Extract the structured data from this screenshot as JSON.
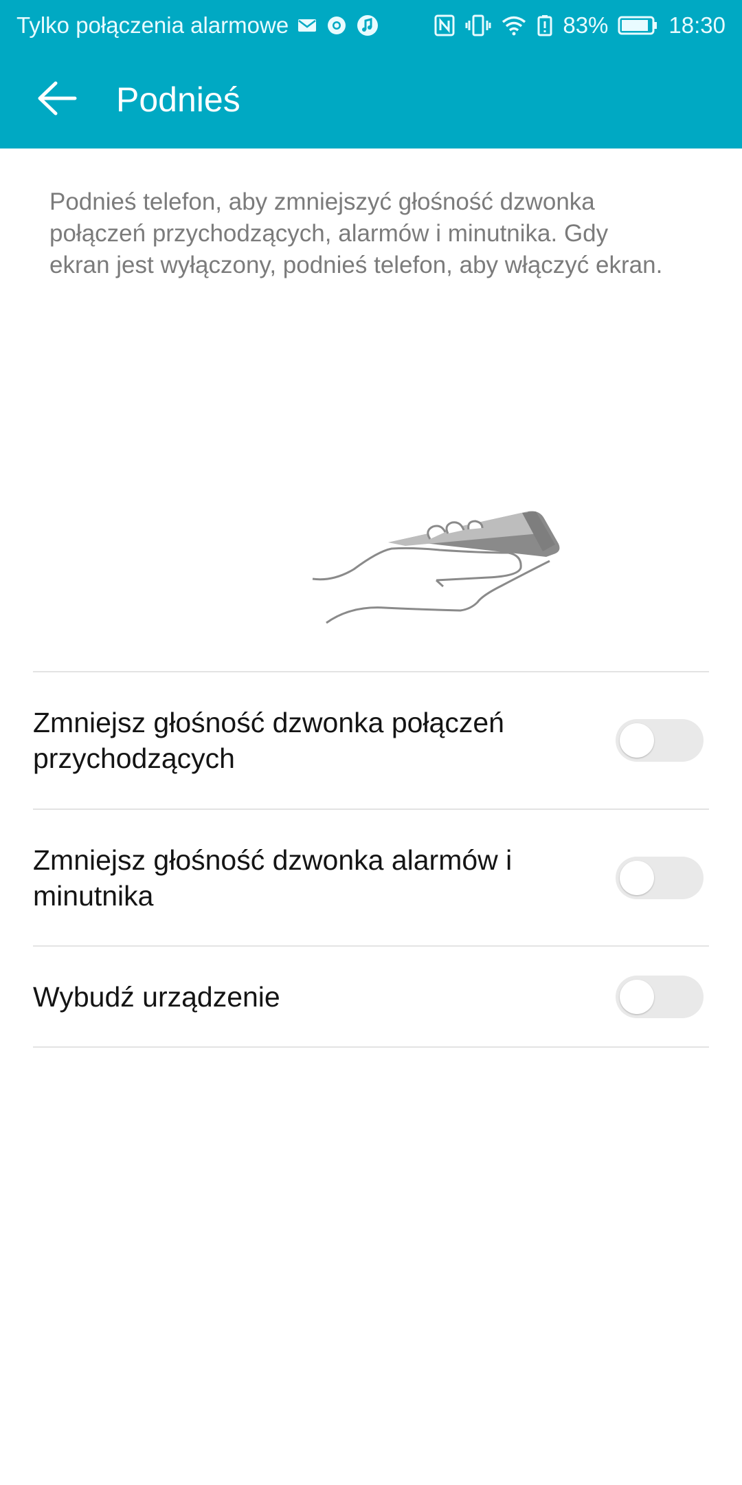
{
  "status_bar": {
    "left_text": "Tylko połączenia alarmowe",
    "icons": [
      "mail-icon",
      "chrome-icon",
      "music-icon",
      "nfc-icon",
      "vibrate-icon",
      "wifi-icon",
      "battery-alert-icon",
      "battery-icon"
    ],
    "battery_percent": "83%",
    "time": "18:30"
  },
  "app_bar": {
    "title": "Podnieś",
    "back_icon": "back-arrow-icon"
  },
  "description": "Podnieś telefon, aby zmniejszyć głośność dzwonka połączeń przychodzących, alarmów i minutnika. Gdy ekran jest wyłączony, podnieś telefon, aby włączyć ekran.",
  "settings": [
    {
      "label": "Zmniejsz głośność dzwonka połączeń przychodzących",
      "enabled": false
    },
    {
      "label": "Zmniejsz głośność dzwonka alarmów i minutnika",
      "enabled": false
    },
    {
      "label": "Wybudź urządzenie",
      "enabled": false
    }
  ],
  "colors": {
    "accent": "#00a9c3",
    "text_primary": "#141414",
    "text_secondary": "#7b7b7b",
    "toggle_off": "#e9e9e9"
  }
}
